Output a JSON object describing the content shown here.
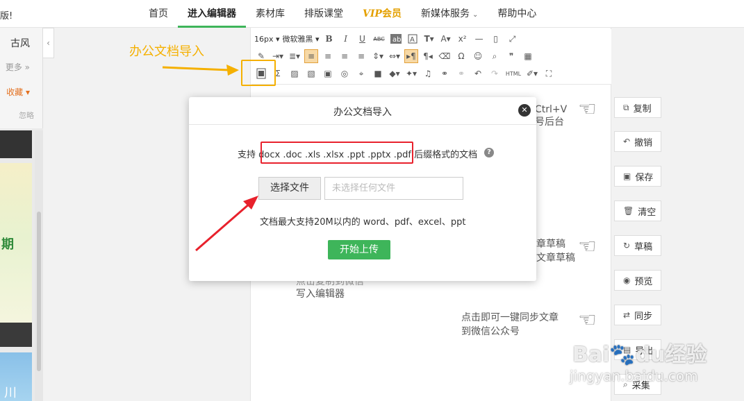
{
  "top_left_text": "版!",
  "nav": {
    "items": [
      {
        "label": "首页",
        "active": false
      },
      {
        "label": "进入编辑器",
        "active": true
      },
      {
        "label": "素材库",
        "active": false
      },
      {
        "label": "排版课堂",
        "active": false
      }
    ],
    "vip_prefix": "VIP",
    "vip_label": "会员",
    "media_service": "新媒体服务",
    "help_center": "帮助中心"
  },
  "left_panel": {
    "gufeng": "古风",
    "more": "更多",
    "favorite": "收藏",
    "ignore": "忽略",
    "thumb_text": "期",
    "thumb_text_2": "川"
  },
  "toolbar": {
    "font_size": "16px",
    "font_family": "微软雅黑",
    "bold": "B",
    "italic": "I",
    "underline": "U",
    "strikethrough": "ABC",
    "superscript": "x²",
    "omega": "Ω",
    "html": "HTML"
  },
  "annotation": {
    "label": "办公文档导入"
  },
  "modal": {
    "title": "办公文档导入",
    "support_prefix": "支持",
    "extensions": "docx .doc .xls .xlsx .ppt .pptx .pdf",
    "support_suffix": "后缀格式的文档",
    "choose_file": "选择文件",
    "file_placeholder": "未选择任何文件",
    "limit": "文档最大支持20M以内的 word、pdf、excel、ppt",
    "upload": "开始上传"
  },
  "background_hints": {
    "h1a": "Ctrl+V",
    "h1b": "号后台",
    "h2a": "章草稿",
    "h2b": "文章草稿",
    "h3a": "点击复制到微信",
    "h3b": "写入编辑器",
    "h4a": "点击即可一键同步文章",
    "h4b": "到微信公众号"
  },
  "right_sidebar": {
    "buttons": [
      {
        "label": "复制",
        "icon": "copy-icon"
      },
      {
        "label": "撤销",
        "icon": "undo-icon"
      },
      {
        "label": "保存",
        "icon": "save-icon"
      },
      {
        "label": "清空",
        "icon": "trash-icon"
      },
      {
        "label": "草稿",
        "icon": "draft-icon"
      },
      {
        "label": "预览",
        "icon": "eye-icon"
      },
      {
        "label": "同步",
        "icon": "sync-icon"
      },
      {
        "label": "导出",
        "icon": "export-icon"
      },
      {
        "label": "采集",
        "icon": "collect-icon"
      }
    ]
  },
  "watermark": {
    "brand": "Bai",
    "paw": "du",
    "suffix": "经验",
    "url": "jingyan.baidu.com"
  }
}
